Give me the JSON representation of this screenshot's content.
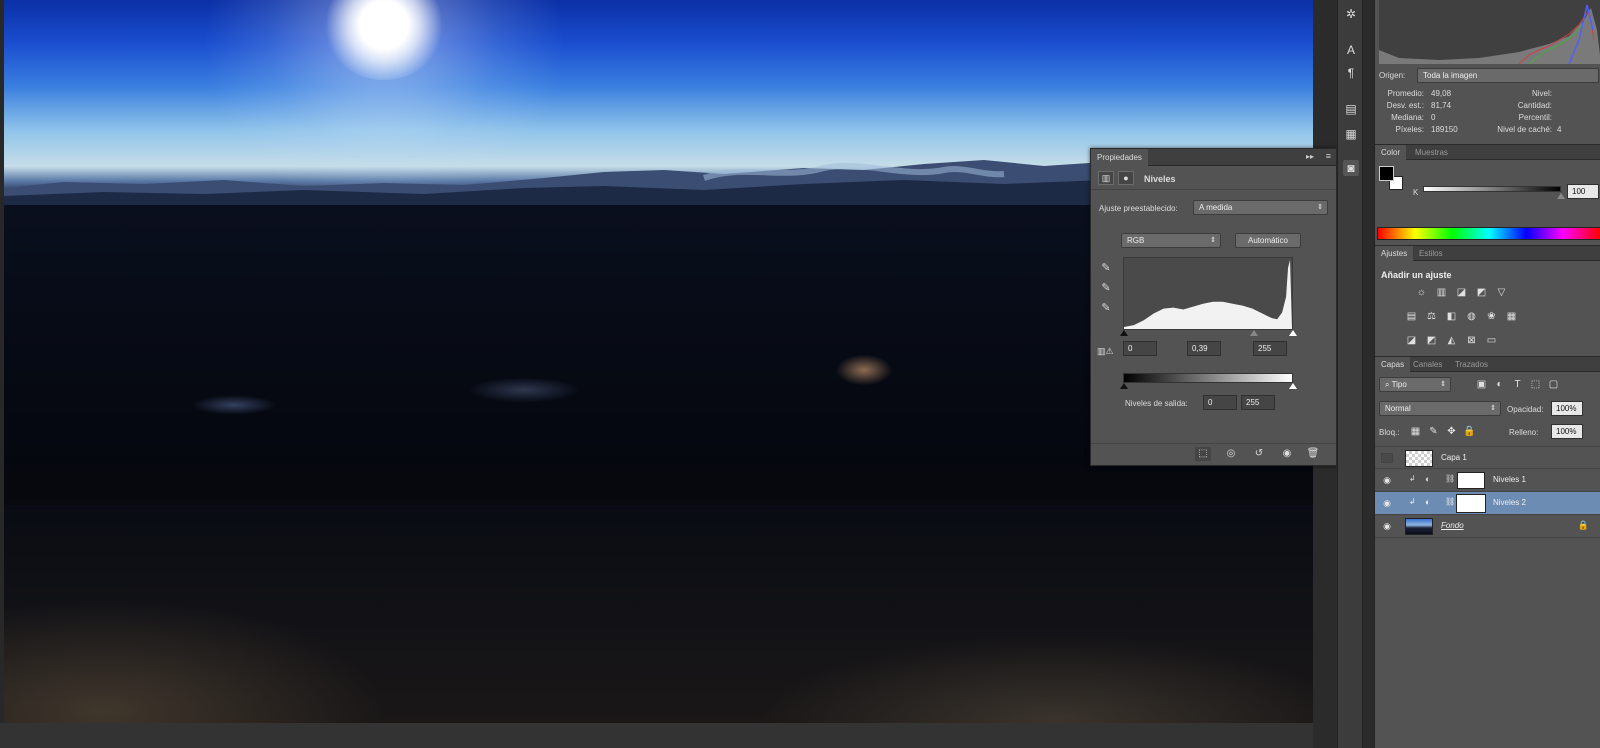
{
  "properties_panel": {
    "tab_active": "Propiedades",
    "title": "Niveles",
    "preset_label": "Ajuste preestablecido:",
    "preset_value": "A medida",
    "channel_value": "RGB",
    "auto_button": "Automático",
    "input_black": "0",
    "input_gamma": "0,39",
    "input_white": "255",
    "output_label": "Niveles de salida:",
    "output_black": "0",
    "output_white": "255"
  },
  "histogram_panel": {
    "origin_label": "Origen:",
    "origin_value": "Toda la imagen",
    "stats_left": [
      {
        "label": "Promedio:",
        "value": "49,08"
      },
      {
        "label": "Desv. est.:",
        "value": "81,74"
      },
      {
        "label": "Mediana:",
        "value": "0"
      },
      {
        "label": "Píxeles:",
        "value": "189150"
      }
    ],
    "stats_right": [
      {
        "label": "Nivel:",
        "value": ""
      },
      {
        "label": "Cantidad:",
        "value": ""
      },
      {
        "label": "Percentil:",
        "value": ""
      },
      {
        "label": "Nivel de caché:",
        "value": "4"
      }
    ]
  },
  "color_panel": {
    "tab_active": "Color",
    "tab_inactive": "Muestras",
    "channel_label": "K",
    "k_value": "100",
    "colors": {
      "foreground": "#000000",
      "background": "#ffffff"
    }
  },
  "adjustments_panel": {
    "tab_active": "Ajustes",
    "tab_inactive": "Estilos",
    "heading": "Añadir un ajuste"
  },
  "layers_panel": {
    "tabs": [
      "Capas",
      "Canales",
      "Trazados"
    ],
    "filter_value": "Tipo",
    "blend_mode": "Normal",
    "opacity_label": "Opacidad:",
    "opacity_value": "100%",
    "lock_label": "Bloq.:",
    "fill_label": "Relleno:",
    "fill_value": "100%",
    "layers": [
      {
        "name": "Capa 1",
        "visible": false,
        "selected": false
      },
      {
        "name": "Niveles 1",
        "visible": true,
        "selected": false
      },
      {
        "name": "Niveles 2",
        "visible": true,
        "selected": true
      },
      {
        "name": "Fondo",
        "visible": true,
        "selected": false
      }
    ],
    "selection_color": "#6d8cb3"
  },
  "tool_strip": {
    "icons": [
      "bug-icon",
      "character-icon",
      "paragraph-icon",
      "notes-icon",
      "history-icon",
      "properties-icon"
    ]
  }
}
